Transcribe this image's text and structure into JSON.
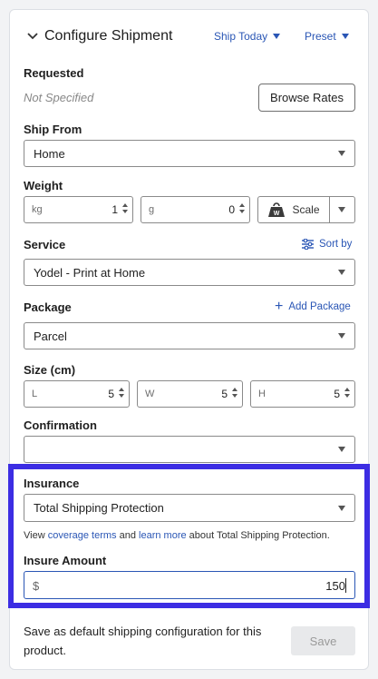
{
  "header": {
    "title": "Configure Shipment",
    "ship_today": "Ship Today",
    "preset": "Preset"
  },
  "requested": {
    "label": "Requested",
    "value": "Not Specified",
    "browse_rates": "Browse Rates"
  },
  "ship_from": {
    "label": "Ship From",
    "value": "Home"
  },
  "weight": {
    "label": "Weight",
    "kg_unit": "kg",
    "kg_value": "1",
    "g_unit": "g",
    "g_value": "0",
    "scale_label": "Scale",
    "scale_badge": "W"
  },
  "service": {
    "label": "Service",
    "sort_by": "Sort by",
    "value": "Yodel - Print at Home"
  },
  "package": {
    "label": "Package",
    "add_package": "Add Package",
    "value": "Parcel"
  },
  "size": {
    "label": "Size (cm)",
    "l_unit": "L",
    "l_value": "5",
    "w_unit": "W",
    "w_value": "5",
    "h_unit": "H",
    "h_value": "5"
  },
  "confirmation": {
    "label": "Confirmation",
    "value": ""
  },
  "insurance": {
    "label": "Insurance",
    "value": "Total Shipping Protection",
    "desc_view": "View",
    "desc_coverage": "coverage terms",
    "desc_and": "and",
    "desc_learn": "learn more",
    "desc_about": "about Total Shipping Protection.",
    "amount_label": "Insure Amount",
    "currency": "$",
    "amount_value": "150"
  },
  "footer": {
    "default_text": "Save as default shipping configuration for this product.",
    "save": "Save"
  },
  "colors": {
    "accent": "#2a56b5",
    "highlight": "#3c2de3"
  }
}
